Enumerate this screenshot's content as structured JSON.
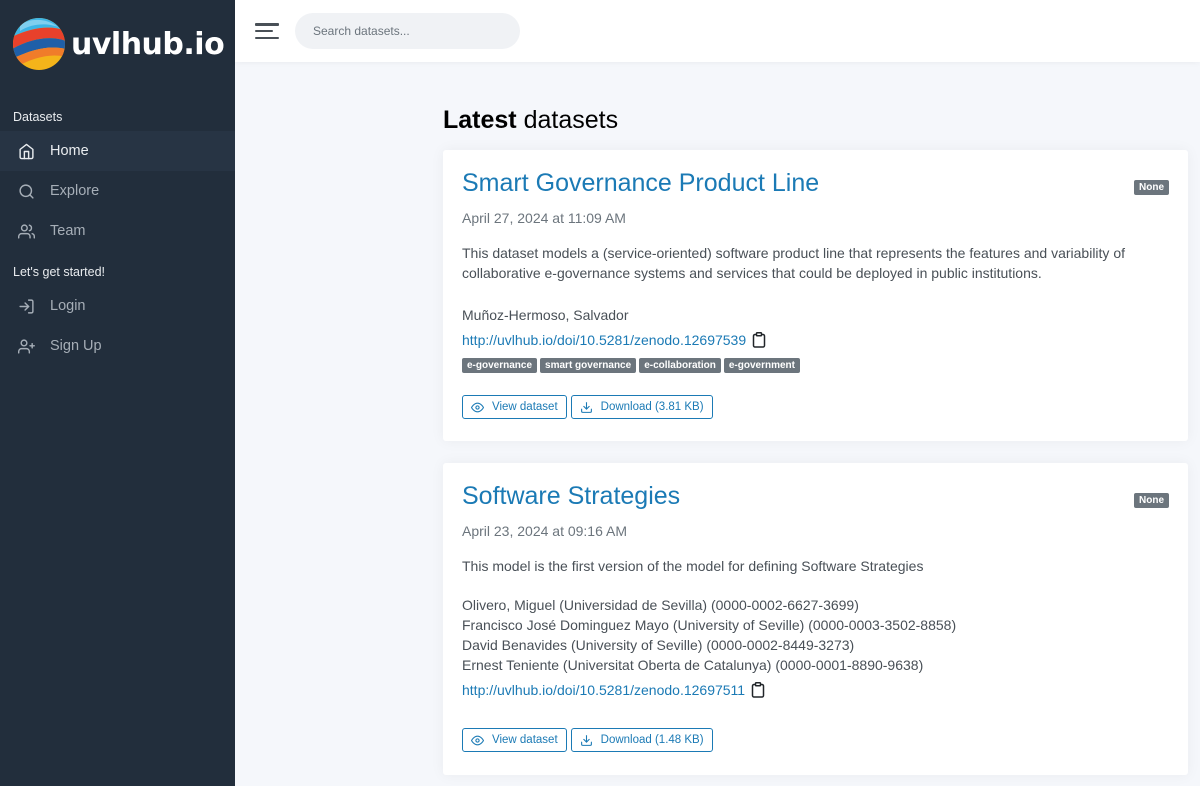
{
  "brand": {
    "name": "uvlhub.io"
  },
  "sidebar": {
    "section1": "Datasets",
    "items1": [
      {
        "label": "Home",
        "icon": "home-icon",
        "active": true
      },
      {
        "label": "Explore",
        "icon": "search-icon"
      },
      {
        "label": "Team",
        "icon": "users-icon"
      }
    ],
    "section2": "Let's get started!",
    "items2": [
      {
        "label": "Login",
        "icon": "log-in-icon"
      },
      {
        "label": "Sign Up",
        "icon": "user-plus-icon"
      }
    ]
  },
  "topbar": {
    "search_placeholder": "Search datasets..."
  },
  "main": {
    "title_bold": "Latest",
    "title_rest": " datasets",
    "datasets": [
      {
        "title": "Smart Governance Product Line",
        "badge": "None",
        "date": "April 27, 2024 at 11:09 AM",
        "description": "This dataset models a (service-oriented) software product line that represents the features and variability of collaborative e-governance systems and services that could be deployed in public institutions.",
        "authors": [
          "Muñoz-Hermoso, Salvador"
        ],
        "doi": "http://uvlhub.io/doi/10.5281/zenodo.12697539",
        "tags": [
          "e-governance",
          "smart governance",
          "e-collaboration",
          "e-government"
        ],
        "view_label": "View dataset",
        "download_label": "Download (3.81 KB)"
      },
      {
        "title": "Software Strategies",
        "badge": "None",
        "date": "April 23, 2024 at 09:16 AM",
        "description": "This model is the first version of the model for defining Software Strategies",
        "authors": [
          "Olivero, Miguel (Universidad de Sevilla) (0000-0002-6627-3699)",
          "Francisco José Dominguez Mayo (University of Seville) (0000-0003-3502-8858)",
          "David Benavides (University of Seville) (0000-0002-8449-3273)",
          "Ernest Teniente (Universitat Oberta de Catalunya) (0000-0001-8890-9638)"
        ],
        "doi": "http://uvlhub.io/doi/10.5281/zenodo.12697511",
        "tags": [],
        "view_label": "View dataset",
        "download_label": "Download (1.48 KB)"
      }
    ]
  }
}
